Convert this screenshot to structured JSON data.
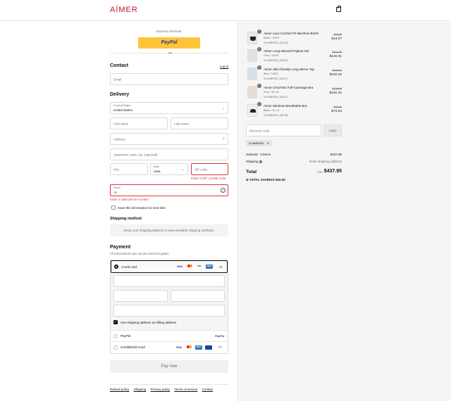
{
  "header": {
    "logo": "AÍMER",
    "cart_icon": "shopping-bag-icon"
  },
  "express": {
    "label": "Express checkout",
    "paypal": "PayPal",
    "or": "OR"
  },
  "contact": {
    "title": "Contact",
    "login": "Log in",
    "email_placeholder": "Email"
  },
  "delivery": {
    "title": "Delivery",
    "country_label": "Country/Region",
    "country_value": "United States",
    "first_name": "First name",
    "last_name": "Last name",
    "address": "Address",
    "apartment": "Apartment, suite, etc. (optional)",
    "city": "City",
    "state_label": "State",
    "state_value": "Iowa",
    "zip": "ZIP code",
    "zip_error": "Enter a ZIP / postal code",
    "phone_label": "Phone",
    "phone_value": "+1",
    "phone_error": "Enter a valid phone number",
    "save_info": "Save this information for next time"
  },
  "shipping": {
    "title": "Shipping method",
    "message": "Enter your shipping address to view available shipping methods."
  },
  "payment": {
    "title": "Payment",
    "subtitle": "All transactions are secure and encrypted.",
    "credit_card": "Credit card",
    "card_more": "+3",
    "billing_same": "Use shipping address as billing address",
    "paypal": "PayPal",
    "credit_debit": "Credit/Debit Card",
    "cd_more": "+7",
    "pay_now": "Pay now",
    "card_logos": [
      "VISA",
      "MC",
      "DISC",
      "AMEX"
    ]
  },
  "footer": {
    "links": [
      "Refund policy",
      "Shipping",
      "Privacy policy",
      "Terms of service",
      "Contact"
    ]
  },
  "cart": {
    "items": [
      {
        "qty": "1",
        "name": "Aimer Lace Comfort Fit Mid-Rise Briefs",
        "variant": "Black / 160/S",
        "code": "AIMER20 (-$2.62)",
        "old": "$15.99",
        "price": "$13.37"
      },
      {
        "qty": "1",
        "name": "Aimer Long-sleeved Pajama Set",
        "variant": "Grey / 160/S",
        "code": "AIMER20 (-$6.69)",
        "old": "$152.99",
        "price": "$146.31"
      },
      {
        "qty": "1",
        "name": "Aimer Skin-friendly Long-sleeve Top",
        "variant": "Blue / 160/S",
        "code": "AIMER20 (-$4.67)",
        "old": "$106.99",
        "price": "$102.32"
      },
      {
        "qty": "1",
        "name": "Aimer CHUANG Full-Coverage Bra",
        "variant": "Grey / 34 / B",
        "code": "AIMER20 (-$4.67)",
        "old": "$106.99",
        "price": "$102.32"
      },
      {
        "qty": "1",
        "name": "Aimer Wireless Breathable Bra",
        "variant": "Black / 32 / A",
        "code": "AIMER20 (-$3.36)",
        "old": "$76.99",
        "price": "$73.63"
      }
    ],
    "discount_placeholder": "Discount code",
    "apply": "Apply",
    "applied_code": "AIMER20",
    "subtotal_label": "Subtotal · 5 items",
    "subtotal": "$437.95",
    "shipping_label": "Shipping",
    "shipping_value": "Enter shipping address",
    "total_label": "Total",
    "currency": "USD",
    "total": "$437.95",
    "savings_label": "TOTAL SAVINGS",
    "savings": "$20.00"
  }
}
